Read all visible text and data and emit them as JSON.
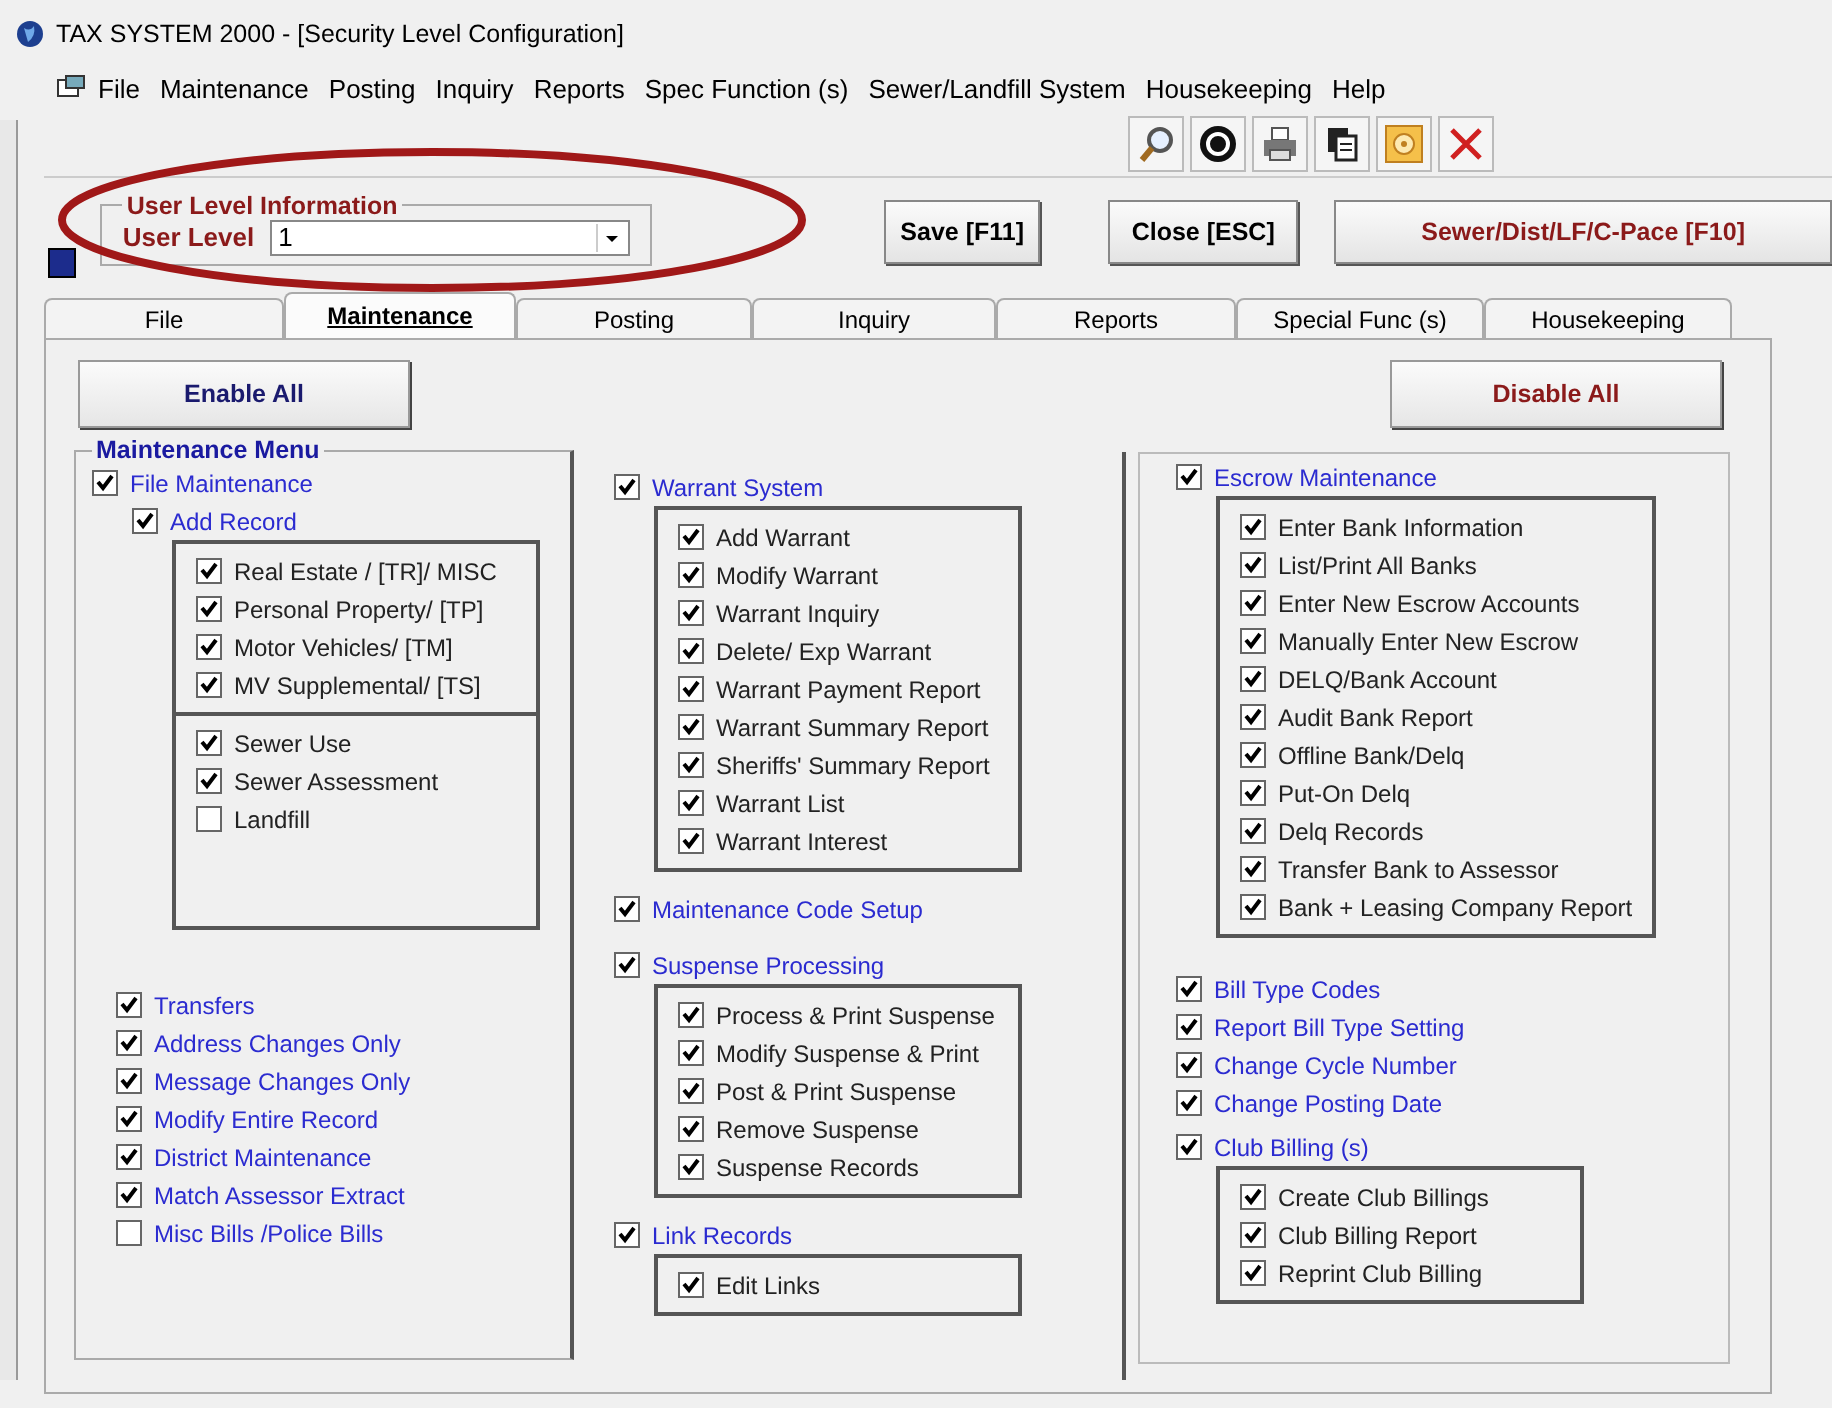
{
  "window": {
    "title": "TAX SYSTEM 2000  - [Security Level Configuration]"
  },
  "menu": [
    "File",
    "Maintenance",
    "Posting",
    "Inquiry",
    "Reports",
    "Spec Function (s)",
    "Sewer/Landfill System",
    "Housekeeping",
    "Help"
  ],
  "user_level_group": {
    "legend": "User Level Information",
    "label": "User Level",
    "value": "1"
  },
  "buttons": [
    {
      "label": "Save [F11]",
      "kind": "plain"
    },
    {
      "label": "Close [ESC]",
      "kind": "plain"
    },
    {
      "label": "Sewer/Dist/LF/C-Pace [F10]",
      "kind": "accent"
    }
  ],
  "tabs": [
    {
      "label": "File",
      "selected": false
    },
    {
      "label": "Maintenance",
      "selected": true
    },
    {
      "label": "Posting",
      "selected": false
    },
    {
      "label": "Inquiry",
      "selected": false
    },
    {
      "label": "Reports",
      "selected": false
    },
    {
      "label": "Special Func (s)",
      "selected": false
    },
    {
      "label": "Housekeeping",
      "selected": false
    }
  ],
  "enable_all": "Enable All",
  "disable_all": "Disable All",
  "maintenance_menu": {
    "legend": "Maintenance Menu",
    "columns": [
      [
        {
          "kind": "check",
          "label": "File Maintenance",
          "checked": true,
          "children": [
            {
              "kind": "check",
              "label": "Add Record",
              "checked": true,
              "children": [
                {
                  "kind": "box",
                  "sections": [
                    [
                      {
                        "label": "Real Estate / [TR]/ MISC",
                        "checked": true
                      },
                      {
                        "label": "Personal Property/ [TP]",
                        "checked": true
                      },
                      {
                        "label": "Motor Vehicles/ [TM]",
                        "checked": true
                      },
                      {
                        "label": "MV Supplemental/ [TS]",
                        "checked": true
                      }
                    ],
                    [
                      {
                        "label": "Sewer Use",
                        "checked": true
                      },
                      {
                        "label": "Sewer Assessment",
                        "checked": true
                      },
                      {
                        "label": "Landfill",
                        "checked": false
                      }
                    ]
                  ]
                }
              ]
            }
          ]
        },
        {
          "kind": "list",
          "items": [
            {
              "label": "Transfers",
              "checked": true
            },
            {
              "label": "Address Changes Only",
              "checked": true
            },
            {
              "label": "Message Changes Only",
              "checked": true
            },
            {
              "label": "Modify Entire Record",
              "checked": true
            },
            {
              "label": "District Maintenance",
              "checked": true
            },
            {
              "label": "Match Assessor Extract",
              "checked": true
            },
            {
              "label": "Misc Bills /Police Bills",
              "checked": false
            }
          ]
        }
      ],
      [
        {
          "kind": "check",
          "label": "Warrant System",
          "checked": true,
          "children": [
            {
              "kind": "box",
              "sections": [
                [
                  {
                    "label": "Add Warrant",
                    "checked": true
                  },
                  {
                    "label": "Modify Warrant",
                    "checked": true
                  },
                  {
                    "label": "Warrant Inquiry",
                    "checked": true
                  },
                  {
                    "label": "Delete/ Exp Warrant",
                    "checked": true
                  },
                  {
                    "label": "Warrant Payment Report",
                    "checked": true
                  },
                  {
                    "label": "Warrant Summary Report",
                    "checked": true
                  },
                  {
                    "label": "Sheriffs' Summary Report",
                    "checked": true
                  },
                  {
                    "label": "Warrant List",
                    "checked": true
                  },
                  {
                    "label": "Warrant Interest",
                    "checked": true
                  }
                ]
              ]
            }
          ]
        },
        {
          "kind": "check",
          "label": "Maintenance Code Setup",
          "checked": true
        },
        {
          "kind": "check",
          "label": "Suspense Processing",
          "checked": true,
          "children": [
            {
              "kind": "box",
              "sections": [
                [
                  {
                    "label": "Process & Print Suspense",
                    "checked": true
                  },
                  {
                    "label": "Modify Suspense & Print",
                    "checked": true
                  },
                  {
                    "label": "Post & Print Suspense",
                    "checked": true
                  },
                  {
                    "label": "Remove Suspense",
                    "checked": true
                  },
                  {
                    "label": "Suspense Records",
                    "checked": true
                  }
                ]
              ]
            }
          ]
        },
        {
          "kind": "check",
          "label": "Link Records",
          "checked": true,
          "children": [
            {
              "kind": "box",
              "sections": [
                [
                  {
                    "label": "Edit Links",
                    "checked": true
                  }
                ]
              ]
            }
          ]
        }
      ],
      [
        {
          "kind": "check",
          "label": "Escrow Maintenance",
          "checked": true,
          "children": [
            {
              "kind": "box",
              "sections": [
                [
                  {
                    "label": "Enter Bank Information",
                    "checked": true
                  },
                  {
                    "label": "List/Print All Banks",
                    "checked": true
                  },
                  {
                    "label": "Enter New Escrow Accounts",
                    "checked": true
                  },
                  {
                    "label": "Manually Enter New Escrow",
                    "checked": true
                  },
                  {
                    "label": "DELQ/Bank Account",
                    "checked": true
                  },
                  {
                    "label": "Audit Bank Report",
                    "checked": true
                  },
                  {
                    "label": "Offline Bank/Delq",
                    "checked": true
                  },
                  {
                    "label": "Put-On Delq",
                    "checked": true
                  },
                  {
                    "label": "Delq Records",
                    "checked": true
                  },
                  {
                    "label": "Transfer Bank to Assessor",
                    "checked": true
                  },
                  {
                    "label": "Bank + Leasing Company Report",
                    "checked": true
                  }
                ]
              ]
            }
          ]
        },
        {
          "kind": "list",
          "items": [
            {
              "label": "Bill Type Codes",
              "checked": true
            },
            {
              "label": "Report Bill Type Setting",
              "checked": true
            },
            {
              "label": "Change Cycle Number",
              "checked": true
            },
            {
              "label": "Change Posting Date",
              "checked": true
            }
          ]
        },
        {
          "kind": "check",
          "label": "Club Billing (s)",
          "checked": true,
          "children": [
            {
              "kind": "box",
              "sections": [
                [
                  {
                    "label": "Create Club Billings",
                    "checked": true
                  },
                  {
                    "label": "Club Billing Report",
                    "checked": true
                  },
                  {
                    "label": "Reprint Club Billing",
                    "checked": true
                  }
                ]
              ]
            }
          ]
        }
      ]
    ]
  }
}
